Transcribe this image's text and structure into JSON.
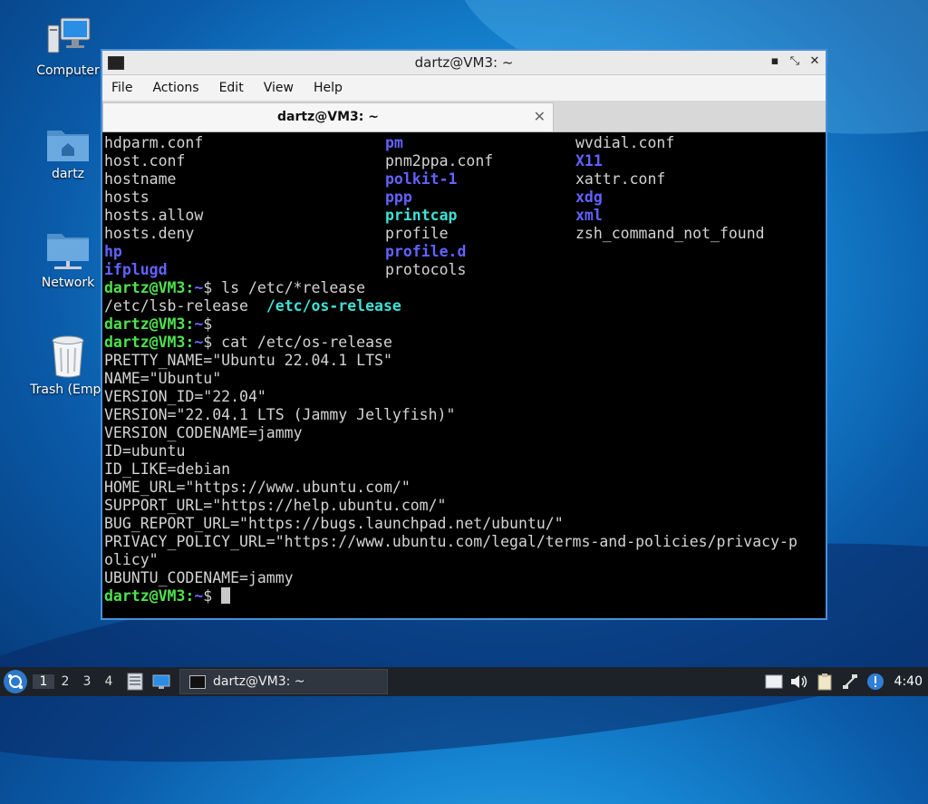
{
  "desktop": {
    "icons": [
      {
        "label": "Computer",
        "icon": "computer-icon"
      },
      {
        "label": "dartz",
        "icon": "home-folder-icon"
      },
      {
        "label": "Network",
        "icon": "network-folder-icon"
      },
      {
        "label": "Trash (Empt",
        "icon": "trash-icon"
      }
    ]
  },
  "window": {
    "title": "dartz@VM3: ~",
    "buttons": {
      "minimize": "▪",
      "maximize": "⤡",
      "close": "✕"
    },
    "menu": [
      "File",
      "Actions",
      "Edit",
      "View",
      "Help"
    ],
    "tab": {
      "label": "dartz@VM3: ~",
      "close": "✕"
    }
  },
  "terminal": {
    "listing": [
      [
        "hdparm.conf",
        "pm",
        "wvdial.conf"
      ],
      [
        "host.conf",
        "pnm2ppa.conf",
        "X11"
      ],
      [
        "hostname",
        "polkit-1",
        "xattr.conf"
      ],
      [
        "hosts",
        "ppp",
        "xdg"
      ],
      [
        "hosts.allow",
        "printcap",
        "xml"
      ],
      [
        "hosts.deny",
        "profile",
        "zsh_command_not_found"
      ],
      [
        "hp",
        "profile.d",
        ""
      ],
      [
        "ifplugd",
        "protocols",
        ""
      ]
    ],
    "prompt_user": "dartz@VM3:",
    "prompt_dir": "~",
    "prompt_sign": "$",
    "cmd1": " ls /etc/*release",
    "release_file1": "/etc/lsb-release",
    "release_file2": "/etc/os-release",
    "cmd2": "",
    "cmd3": " cat /etc/os-release",
    "output": [
      "PRETTY_NAME=\"Ubuntu 22.04.1 LTS\"",
      "NAME=\"Ubuntu\"",
      "VERSION_ID=\"22.04\"",
      "VERSION=\"22.04.1 LTS (Jammy Jellyfish)\"",
      "VERSION_CODENAME=jammy",
      "ID=ubuntu",
      "ID_LIKE=debian",
      "HOME_URL=\"https://www.ubuntu.com/\"",
      "SUPPORT_URL=\"https://help.ubuntu.com/\"",
      "BUG_REPORT_URL=\"https://bugs.launchpad.net/ubuntu/\"",
      "PRIVACY_POLICY_URL=\"https://www.ubuntu.com/legal/terms-and-policies/privacy-p",
      "olicy\"",
      "UBUNTU_CODENAME=jammy"
    ]
  },
  "taskbar": {
    "workspaces": [
      "1",
      "2",
      "3",
      "4"
    ],
    "active_workspace": "1",
    "app_label": "dartz@VM3: ~",
    "clock": "4:40",
    "tray_icons": [
      "display-icon",
      "volume-icon",
      "clipboard-icon",
      "network-icon",
      "update-notifier-icon"
    ]
  },
  "colors": {
    "prompt": "#4ee24e",
    "path": "#6a6aff",
    "directory": "#6262ff",
    "special_file": "#3fe0d6"
  }
}
